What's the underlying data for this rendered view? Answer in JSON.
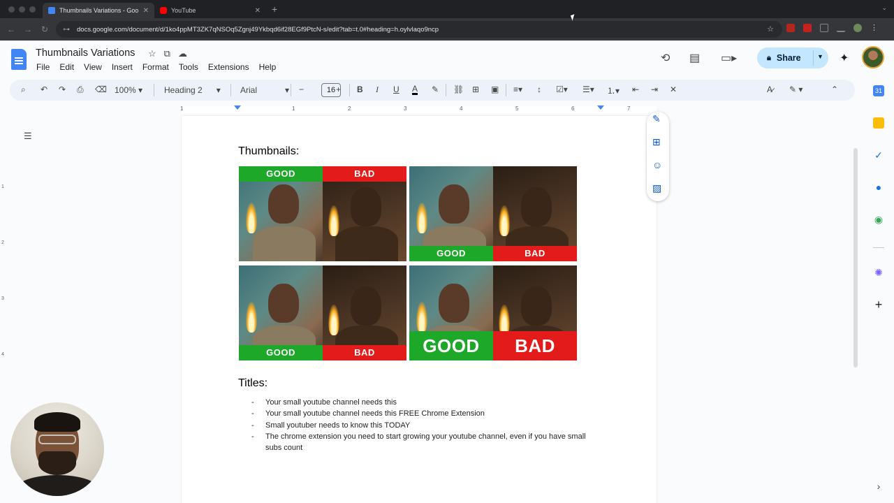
{
  "browser": {
    "tabs": [
      {
        "title": "Thumbnails Variations - Goo",
        "active": true,
        "favicon_color": "#4285f4"
      },
      {
        "title": "YouTube",
        "active": false,
        "favicon_color": "#ff0000"
      }
    ],
    "url": "docs.google.com/document/d/1ko4ppMT3ZK7qNSOq5Zgnj49Ykbqd6if28EGf9PtcN-s/edit?tab=t.0#heading=h.oylvlaqo9ncp",
    "new_tab_icon": "plus-icon",
    "close_tab_icon": "close-icon"
  },
  "doc": {
    "title": "Thumbnails Variations",
    "menu": [
      "File",
      "Edit",
      "View",
      "Insert",
      "Format",
      "Tools",
      "Extensions",
      "Help"
    ],
    "share_label": "Share"
  },
  "toolbar": {
    "zoom": "100%",
    "style": "Heading 2",
    "font": "Arial",
    "font_size": "16"
  },
  "ruler": {
    "numbers": [
      "1",
      "1",
      "2",
      "3",
      "4",
      "5",
      "6",
      "7"
    ]
  },
  "page": {
    "thumbnails_heading": "Thumbnails:",
    "titles_heading": "Titles:",
    "thumbnails": [
      {
        "good": "GOOD",
        "bad": "BAD",
        "label_position": "top",
        "big": false
      },
      {
        "good": "GOOD",
        "bad": "BAD",
        "label_position": "bottom",
        "big": false
      },
      {
        "good": "GOOD",
        "bad": "BAD",
        "label_position": "bottom",
        "big": false
      },
      {
        "good": "GOOD",
        "bad": "BAD",
        "label_position": "bottom",
        "big": true
      }
    ],
    "titles": [
      "Your small youtube channel needs this",
      "Your small youtube channel needs this FREE Chrome Extension",
      "Small youtuber needs to know this TODAY",
      "The chrome extension you need to start growing your youtube channel, even if you have small subs count"
    ]
  },
  "colors": {
    "good": "#1ea82a",
    "bad": "#e31b1b",
    "share_bg": "#c2e7ff",
    "toolbar_bg": "#edf2fa",
    "accent": "#0b57d0"
  }
}
